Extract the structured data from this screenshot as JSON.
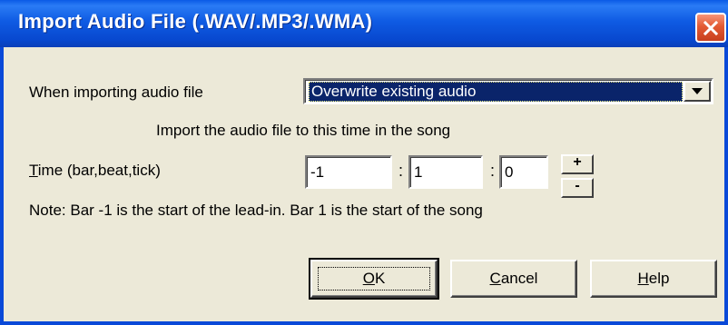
{
  "window": {
    "title": "Import Audio File (.WAV/.MP3/.WMA)",
    "close_glyph": "✕"
  },
  "import_mode": {
    "label": "When importing audio file",
    "selected": "Overwrite existing audio",
    "arrow_glyph": "▼"
  },
  "instruction": "Import the audio file to this time in the song",
  "time": {
    "label_mnemonic": "T",
    "label_rest": "ime (bar,beat,tick)",
    "bar": "-1",
    "beat": "1",
    "tick": "0",
    "separator": ":",
    "increment_label": "+",
    "decrement_label": "-"
  },
  "note": "Note: Bar -1 is the start of the lead-in. Bar 1 is the start of the song",
  "buttons": {
    "ok_mnemonic": "O",
    "ok_rest": "K",
    "cancel_mnemonic": "C",
    "cancel_rest": "ancel",
    "help_mnemonic": "H",
    "help_rest": "elp"
  },
  "colors": {
    "title_bar": "#0A5AE6",
    "dialog_bg": "#ECE9D8",
    "selection_bg": "#0A246A",
    "close_button": "#E35A33"
  }
}
